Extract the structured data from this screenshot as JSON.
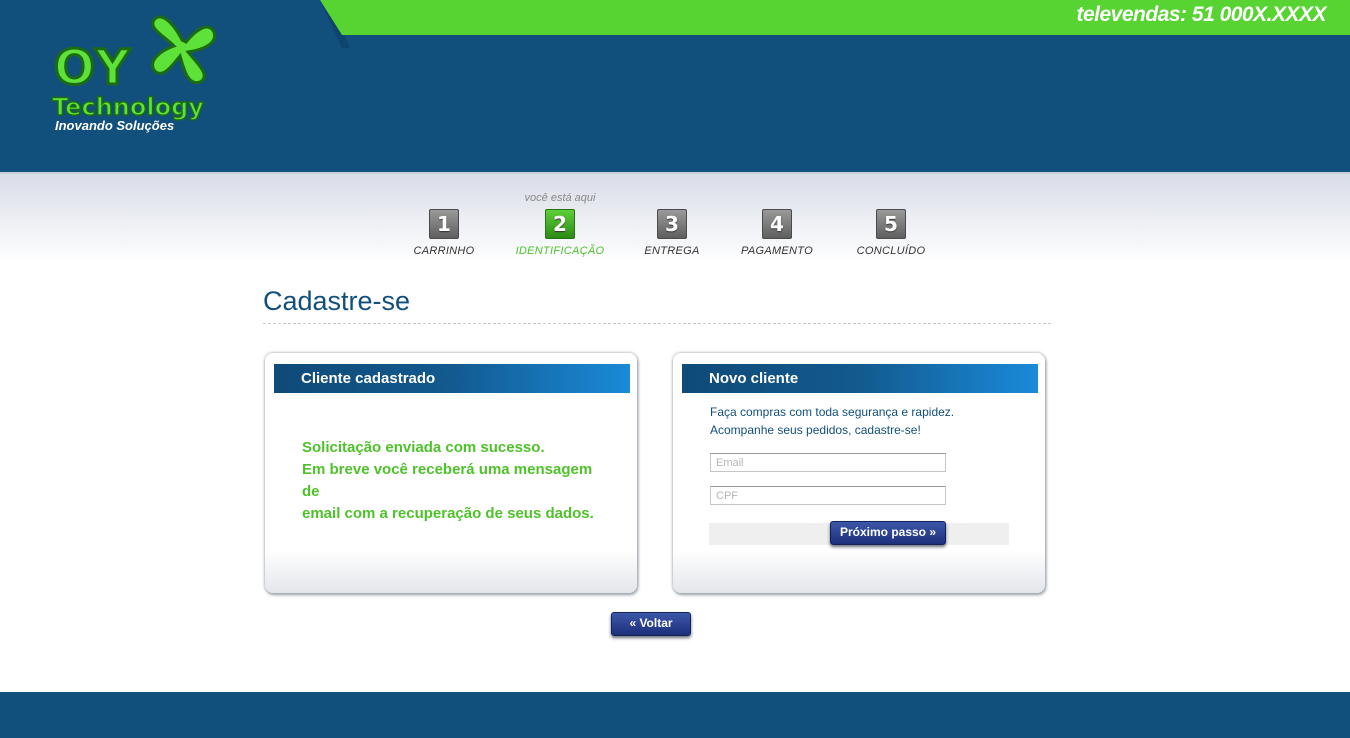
{
  "header": {
    "televendas": "televendas: 51 000X.XXXX",
    "logo_brand": "OY",
    "logo_tech": "Technology",
    "logo_tagline": "Inovando Soluções"
  },
  "steps": {
    "indicator": "você está aqui",
    "items": [
      {
        "number": "1",
        "label": "CARRINHO",
        "active": false
      },
      {
        "number": "2",
        "label": "IDENTIFICAÇÃO",
        "active": true
      },
      {
        "number": "3",
        "label": "ENTREGA",
        "active": false
      },
      {
        "number": "4",
        "label": "PAGAMENTO",
        "active": false
      },
      {
        "number": "5",
        "label": "CONCLUÍDO",
        "active": false
      }
    ]
  },
  "page": {
    "title": "Cadastre-se"
  },
  "registered": {
    "heading": "Cliente cadastrado",
    "message_line1": "Solicitação enviada com sucesso.",
    "message_line2": "Em breve você receberá uma mensagem de",
    "message_line3": "email com a recuperação de seus dados."
  },
  "new_client": {
    "heading": "Novo cliente",
    "intro_line1": "Faça compras com toda segurança e rapidez.",
    "intro_line2": "Acompanhe seus pedidos, cadastre-se!",
    "email_placeholder": "Email",
    "email_value": "",
    "cpf_placeholder": "CPF",
    "cpf_value": "",
    "next_label": "Próximo passo »"
  },
  "actions": {
    "back_label": "« Voltar"
  },
  "colors": {
    "brand_blue": "#114f7d",
    "brand_green": "#57d431",
    "button_blue": "#1d2f7b"
  }
}
